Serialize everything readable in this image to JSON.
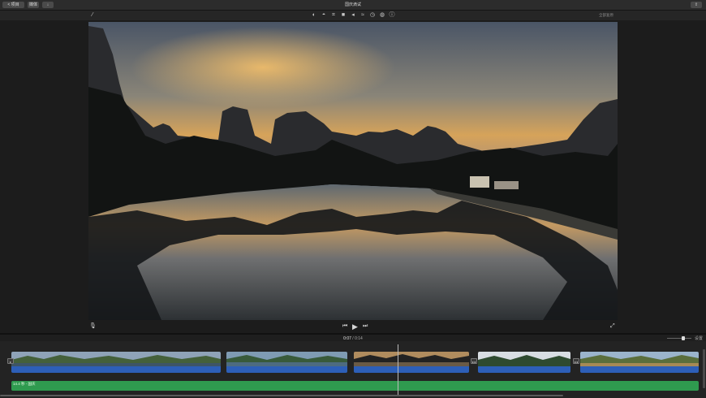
{
  "window": {
    "title": "国庆滴试",
    "back_button": "< 项目",
    "media_button": "媒体",
    "share_icon": "share-icon"
  },
  "toolbar": {
    "reset_all": "全部复原",
    "tools": [
      "color-balance-icon",
      "color-correction-icon",
      "crop-icon",
      "stabilization-icon",
      "volume-icon",
      "noise-reduction-icon",
      "speed-icon",
      "filter-icon",
      "info-icon"
    ]
  },
  "viewer": {
    "microphone_icon": "microphone-icon",
    "fullscreen_icon": "fullscreen-icon"
  },
  "playback": {
    "current_time": "0:07",
    "separator": "/",
    "total_time": "0:14"
  },
  "timeline": {
    "settings_label": "设置",
    "music_label": "14.4 秒 - 国庆",
    "zoom_level": 0.6,
    "colors": {
      "audio": "#2d5fb8",
      "music": "#2f9a4f"
    }
  }
}
